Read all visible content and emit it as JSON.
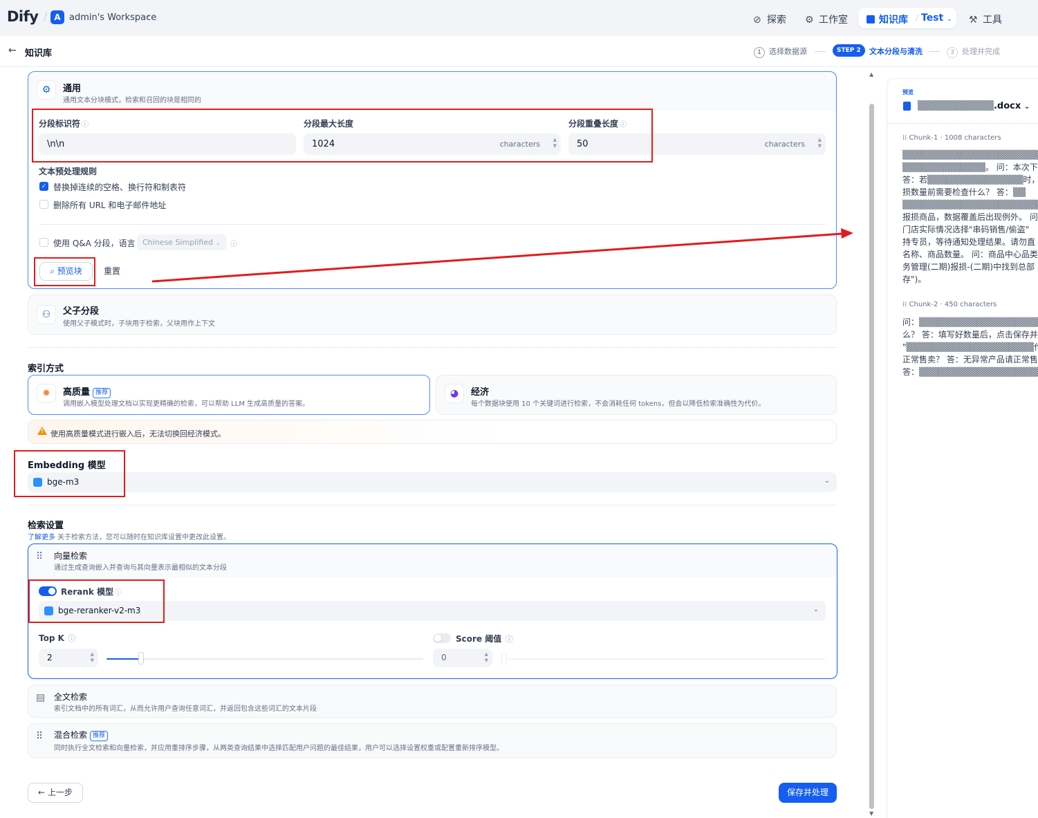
{
  "topbar": {
    "logo": "Dify",
    "workspace_initial": "A",
    "workspace_name": "admin's Workspace",
    "nav": {
      "explore": "探索",
      "studio": "工作室",
      "knowledge": "知识库",
      "knowledge_dataset": "Test",
      "tools": "工具"
    }
  },
  "subbar": {
    "title": "知识库",
    "steps": [
      {
        "num": "1",
        "label": "选择数据源"
      },
      {
        "badge": "STEP 2",
        "label": "文本分段与清洗"
      },
      {
        "num": "3",
        "label": "处理并完成"
      }
    ]
  },
  "general": {
    "title": "通用",
    "desc": "通用文本分块模式，检索和召回的块是相同的",
    "delimiter_label": "分段标识符",
    "delimiter_value": "\\n\\n",
    "max_len_label": "分段最大长度",
    "max_len_value": "1024",
    "max_len_unit": "characters",
    "overlap_label": "分段重叠长度",
    "overlap_value": "50",
    "overlap_unit": "characters",
    "preprocess_title": "文本预处理规则",
    "rule1": "替换掉连续的空格、换行符和制表符",
    "rule1_checked": true,
    "rule2": "删除所有 URL 和电子邮件地址",
    "rule2_checked": false,
    "qa_label": "使用 Q&A 分段，语言",
    "qa_language": "Chinese Simplified",
    "preview_button": "预览块",
    "reset_button": "重置"
  },
  "parent_child": {
    "title": "父子分段",
    "desc": "使用父子模式时，子块用于检索，父块用作上下文"
  },
  "index": {
    "section_title": "索引方式",
    "high_quality_title": "高质量",
    "high_quality_tag": "推荐",
    "high_quality_desc": "调用嵌入模型处理文档以实现更精确的检索，可以帮助 LLM 生成高质量的答案。",
    "economy_title": "经济",
    "economy_desc": "每个数据块使用 10 个关键词进行检索，不会消耗任何 tokens，但会以降低检索准确性为代价。",
    "warning": "使用高质量模式进行嵌入后，无法切换回经济模式。"
  },
  "embedding": {
    "title": "Embedding 模型",
    "model": "bge-m3"
  },
  "retrieval": {
    "section_title": "检索设置",
    "learn_more": "了解更多",
    "hint": "关于检索方法，您可以随时在知识库设置中更改此设置。",
    "vector_title": "向量检索",
    "vector_desc": "通过生成查询嵌入并查询与其向量表示最相似的文本分段",
    "rerank_label": "Rerank 模型",
    "rerank_enabled": true,
    "rerank_model": "bge-reranker-v2-m3",
    "topk_label": "Top K",
    "topk_value": "2",
    "topk_level": 0.11,
    "score_label": "Score 阈值",
    "score_enabled": false,
    "score_value": "0",
    "fulltext_title": "全文检索",
    "fulltext_desc": "索引文档中的所有词汇，从而允许用户查询任意词汇，并返回包含这些词汇的文本片段",
    "hybrid_title": "混合检索",
    "hybrid_tag": "推荐",
    "hybrid_desc": "同时执行全文检索和向量检索，并应用重排序步骤，从两类查询结果中选择匹配用户问题的最佳结果，用户可以选择设置权重或配置重新排序模型。"
  },
  "footer": {
    "prev_button": "上一步",
    "save_button": "保存并处理"
  },
  "preview": {
    "label": "预览",
    "file_suffix": ".docx",
    "chunks": [
      {
        "name": "Chunk-1",
        "chars": "1008 characters",
        "lines": [
          "▒▒▒▒▒▒▒▒▒▒▒▒▒▒▒▒▒▒▒▒▒▒▒▒▒",
          "▒▒▒▒▒▒▒▒▒▒▒▒▒。 问：本次下",
          "答：若▒▒▒▒▒▒▒▒▒▒▒▒▒▒▒时，该",
          "损数量前需要检查什么？ 答：▒▒",
          "▒▒▒▒▒▒▒▒▒▒▒▒▒▒▒▒▒▒▒▒▒▒▒知",
          "报损商品，数据覆盖后出现例外。 问",
          "门店实际情况选择\"串码销售/偷盗\"",
          "持专员，等待通知处理结果。请勿直",
          "名称、商品数量。 问：商品中心品类",
          "务管理(二期)报损-(二期)中找到总部",
          "存\")。"
        ]
      },
      {
        "name": "Chunk-2",
        "chars": "450 characters",
        "lines": [
          "问：▒▒▒▒▒▒▒▒▒▒▒▒▒▒▒▒▒▒▒▒什么",
          "么？ 答：填写好数量后，点击保存并",
          "\"▒▒▒▒▒▒▒▒▒▒▒▒▒▒▒▒▒▒▒▒作完",
          "正常售卖？ 答：无异常产品请正常售",
          "答：▒▒▒▒▒▒▒▒▒▒▒▒▒▒▒▒▒▒▒品类"
        ]
      }
    ]
  },
  "colors": {
    "primary": "#155eef",
    "annotation_red": "#e31b1b",
    "warning": "#f79009"
  }
}
